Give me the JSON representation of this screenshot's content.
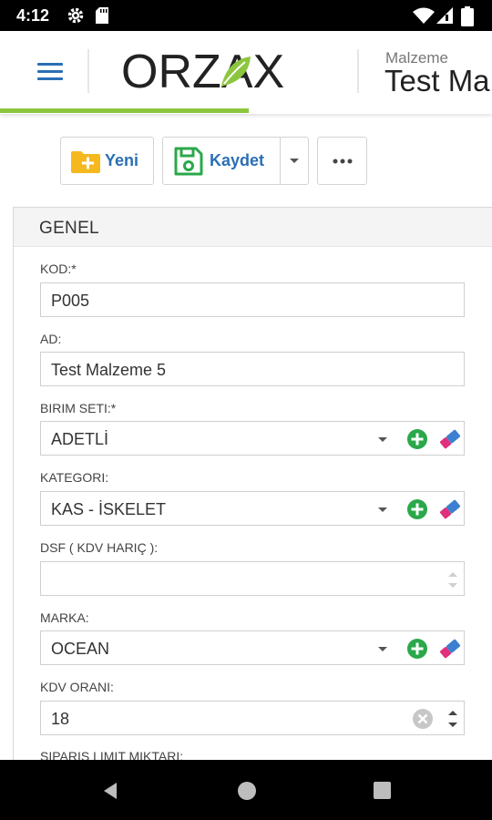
{
  "status_bar": {
    "time": "4:12",
    "icons": [
      "settings-icon",
      "sd-card-icon",
      "wifi-icon",
      "signal-icon",
      "battery-icon"
    ]
  },
  "header": {
    "menu_icon": "hamburger-menu-icon",
    "logo_text": "ORZAX",
    "subtitle": "Malzeme",
    "title": "Test Ma",
    "progress_fraction": 0.5,
    "accent_color": "#2b6fb5",
    "brand_green": "#8cc63f"
  },
  "toolbar": {
    "new_label": "Yeni",
    "save_label": "Kaydet",
    "dropdown_icon": "caret-down-icon",
    "more_icon": "more-horizontal-icon"
  },
  "panel": {
    "title": "GENEL",
    "fields": {
      "kod": {
        "label": "KOD:*",
        "value": "P005"
      },
      "ad": {
        "label": "AD:",
        "value": "Test Malzeme 5"
      },
      "birim_seti": {
        "label": "BIRIM SETI:*",
        "value": "ADETLİ"
      },
      "kategori": {
        "label": "KATEGORI:",
        "value": "KAS - İSKELET"
      },
      "dsf": {
        "label": "DSF ( KDV HARIÇ ):",
        "value": ""
      },
      "marka": {
        "label": "MARKA:",
        "value": "OCEAN"
      },
      "kdv_orani": {
        "label": "KDV ORANI:",
        "value": "18"
      },
      "siparis_limit": {
        "label": "SIPARIŞ LIMIT MIKTARI:"
      }
    }
  },
  "nav_bar": {
    "icons": [
      "back-icon",
      "home-icon",
      "recents-icon"
    ]
  }
}
